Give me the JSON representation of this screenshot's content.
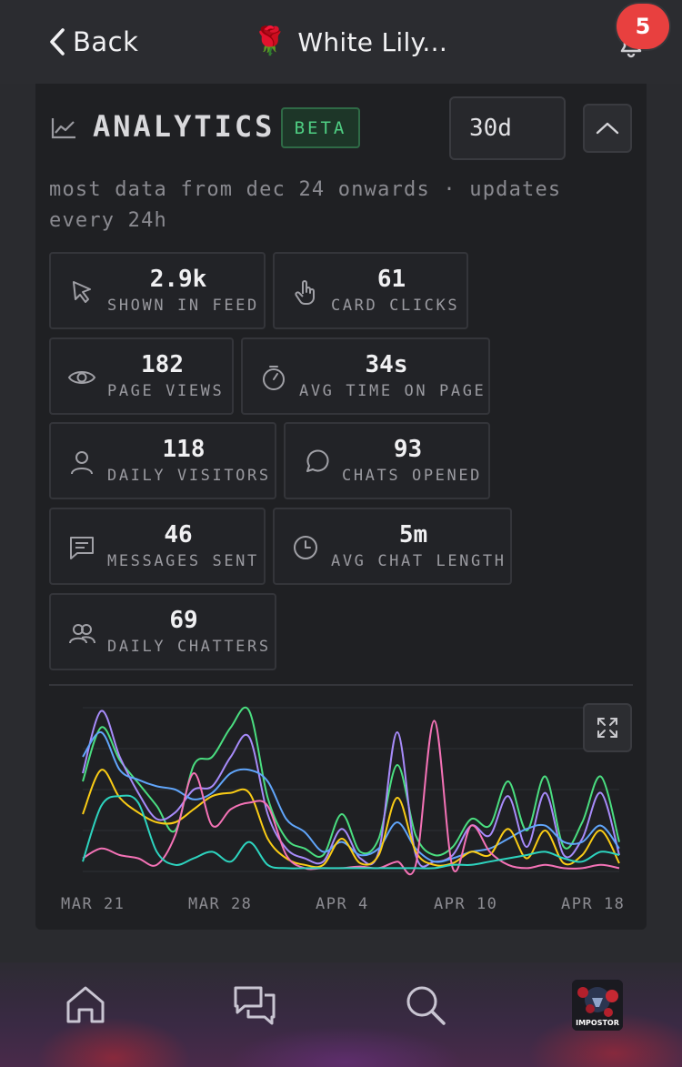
{
  "topbar": {
    "back_label": "Back",
    "title_emoji": "🌹",
    "title": "White Lily...",
    "notification_count": "5"
  },
  "analytics": {
    "title": "ANALYTICS",
    "badge": "BETA",
    "range": "30d",
    "subtitle": "most data from dec 24 onwards · updates every 24h",
    "stats": [
      {
        "value": "2.9k",
        "label": "SHOWN IN FEED",
        "icon": "cursor-icon"
      },
      {
        "value": "61",
        "label": "CARD CLICKS",
        "icon": "tap-icon"
      },
      {
        "value": "182",
        "label": "PAGE VIEWS",
        "icon": "eye-icon"
      },
      {
        "value": "34s",
        "label": "AVG TIME ON PAGE",
        "icon": "timer-icon"
      },
      {
        "value": "118",
        "label": "DAILY VISITORS",
        "icon": "user-icon"
      },
      {
        "value": "93",
        "label": "CHATS OPENED",
        "icon": "chat-bubble-icon"
      },
      {
        "value": "46",
        "label": "MESSAGES SENT",
        "icon": "message-icon"
      },
      {
        "value": "5m",
        "label": "AVG CHAT LENGTH",
        "icon": "clock-icon"
      },
      {
        "value": "69",
        "label": "DAILY CHATTERS",
        "icon": "users-icon"
      }
    ]
  },
  "chart_data": {
    "type": "line",
    "x_labels": [
      "MAR 21",
      "MAR 28",
      "APR 4",
      "APR 10",
      "APR 18"
    ],
    "grid": true,
    "series": [
      {
        "color": "#4ade80",
        "values": [
          55,
          88,
          68,
          54,
          40,
          25,
          65,
          70,
          88,
          98,
          45,
          20,
          14,
          10,
          35,
          12,
          20,
          65,
          22,
          10,
          15,
          32,
          28,
          55,
          25,
          58,
          15,
          30,
          58,
          18
        ]
      },
      {
        "color": "#a78bfa",
        "values": [
          60,
          98,
          70,
          48,
          32,
          36,
          50,
          52,
          70,
          82,
          35,
          14,
          8,
          6,
          26,
          8,
          12,
          85,
          10,
          6,
          10,
          28,
          22,
          46,
          15,
          48,
          10,
          20,
          48,
          10
        ]
      },
      {
        "color": "#60a5fa",
        "values": [
          70,
          85,
          62,
          56,
          52,
          50,
          44,
          48,
          60,
          62,
          55,
          32,
          24,
          12,
          18,
          10,
          14,
          30,
          14,
          6,
          8,
          12,
          14,
          20,
          26,
          28,
          18,
          18,
          28,
          14
        ]
      },
      {
        "color": "#facc15",
        "values": [
          35,
          62,
          45,
          36,
          30,
          30,
          38,
          46,
          48,
          48,
          20,
          8,
          4,
          4,
          20,
          5,
          10,
          45,
          12,
          4,
          5,
          12,
          10,
          26,
          8,
          25,
          5,
          10,
          25,
          5
        ]
      },
      {
        "color": "#f472b6",
        "values": [
          8,
          14,
          10,
          8,
          4,
          22,
          60,
          28,
          38,
          42,
          40,
          10,
          2,
          2,
          2,
          3,
          2,
          6,
          4,
          92,
          2,
          28,
          12,
          4,
          2,
          4,
          2,
          2,
          4,
          2
        ]
      },
      {
        "color": "#2dd4bf",
        "values": [
          6,
          40,
          46,
          42,
          12,
          4,
          8,
          12,
          6,
          18,
          4,
          2,
          2,
          2,
          2,
          2,
          2,
          2,
          2,
          2,
          4,
          4,
          6,
          8,
          10,
          12,
          8,
          6,
          12,
          10
        ]
      }
    ]
  }
}
